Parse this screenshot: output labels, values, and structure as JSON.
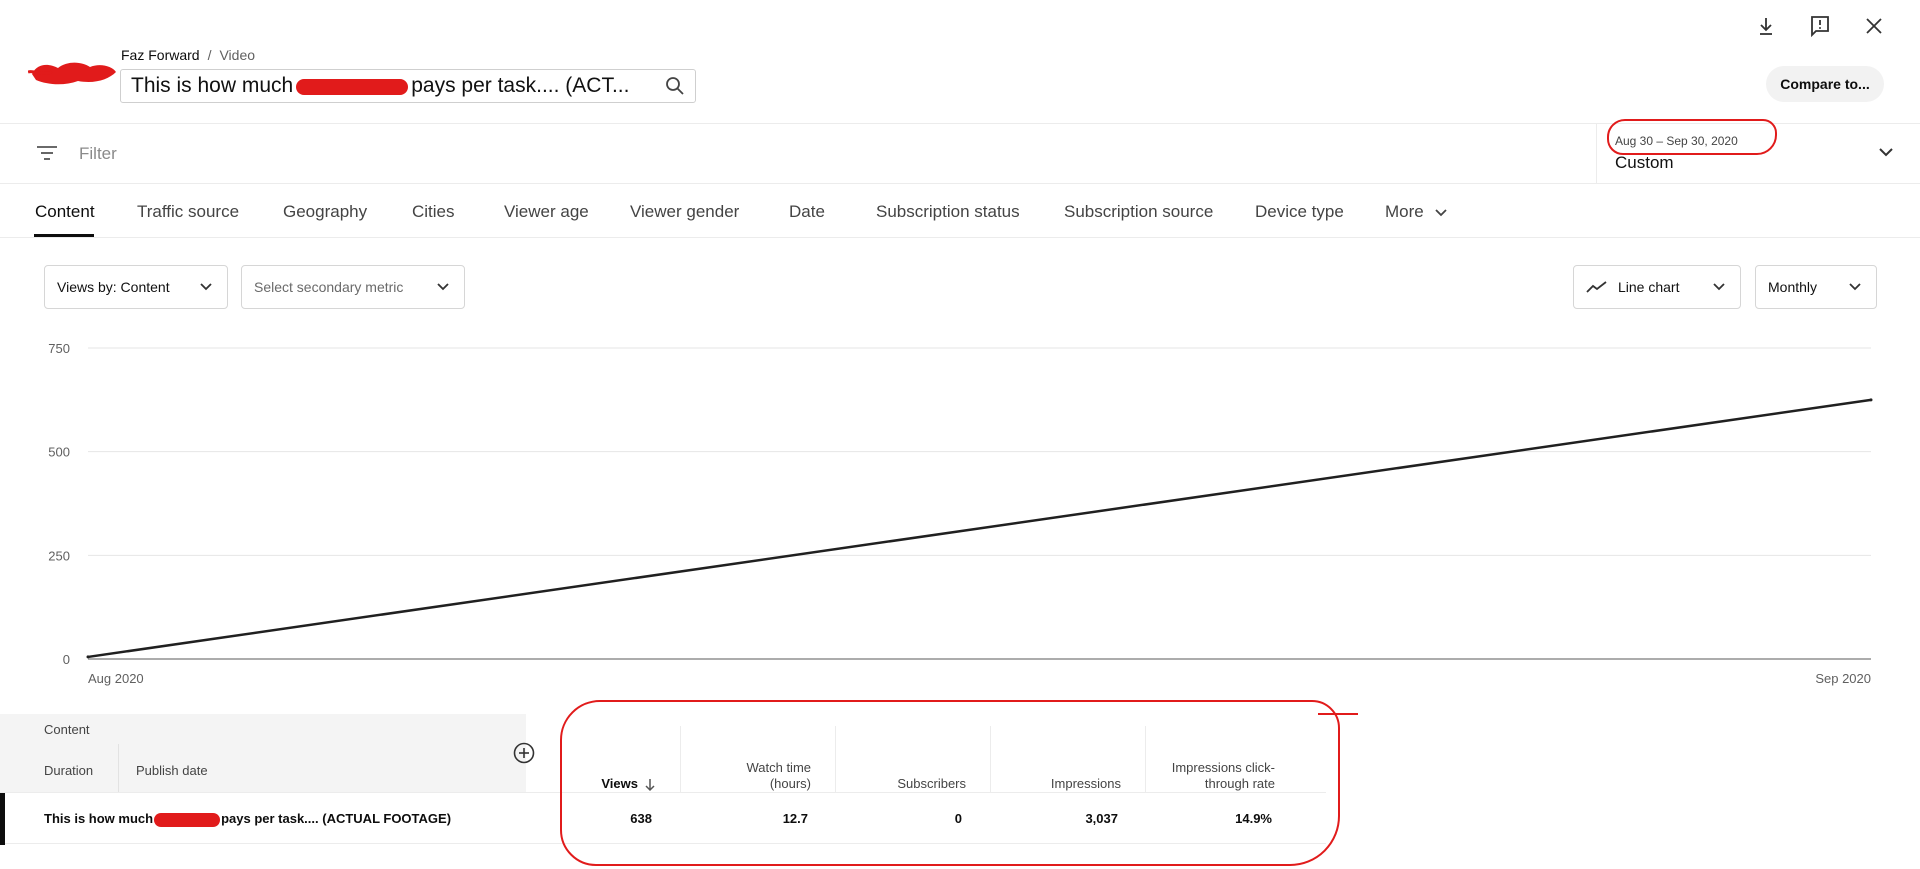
{
  "header": {
    "breadcrumb": {
      "channel": "Faz Forward",
      "separator": "/",
      "section": "Video"
    },
    "title_part1": "This is how much",
    "title_part2": "pays per task.... (ACT...",
    "compare_label": "Compare to..."
  },
  "filter": {
    "label": "Filter",
    "date_range": "Aug 30 – Sep 30, 2020",
    "date_mode": "Custom"
  },
  "tabs": [
    {
      "label": "Content",
      "active": true
    },
    {
      "label": "Traffic source"
    },
    {
      "label": "Geography"
    },
    {
      "label": "Cities"
    },
    {
      "label": "Viewer age"
    },
    {
      "label": "Viewer gender"
    },
    {
      "label": "Date"
    },
    {
      "label": "Subscription status"
    },
    {
      "label": "Subscription source"
    },
    {
      "label": "Device type"
    },
    {
      "label": "More"
    }
  ],
  "controls": {
    "primary_metric": "Views by: Content",
    "secondary_metric": "Select secondary metric",
    "chart_type": "Line chart",
    "interval": "Monthly"
  },
  "chart_data": {
    "type": "line",
    "x": [
      "Aug 2020",
      "Sep 2020"
    ],
    "series": [
      {
        "values": [
          5,
          625
        ]
      }
    ],
    "y_ticks": [
      0,
      250,
      500,
      750
    ],
    "ylim": [
      0,
      750
    ],
    "x_labels": [
      "Aug 2020",
      "Sep 2020"
    ],
    "grid": true,
    "line_color": "#202020"
  },
  "table": {
    "group_label": "Content",
    "col_duration": "Duration",
    "col_publish": "Publish date",
    "columns": [
      {
        "key": "views",
        "label": "Views"
      },
      {
        "key": "watch",
        "label": "Watch time (hours)"
      },
      {
        "key": "subs",
        "label": "Subscribers"
      },
      {
        "key": "impr",
        "label": "Impressions"
      },
      {
        "key": "ctr",
        "label": "Impressions click-through rate"
      }
    ],
    "row": {
      "title_part1": "This is how much",
      "title_part2": "pays per task.... (ACTUAL FOOTAGE)",
      "views": "638",
      "watch": "12.7",
      "subs": "0",
      "impr": "3,037",
      "ctr": "14.9%"
    }
  },
  "colors": {
    "annotation": "#e11b1b",
    "accent": "#0d0d0d"
  }
}
